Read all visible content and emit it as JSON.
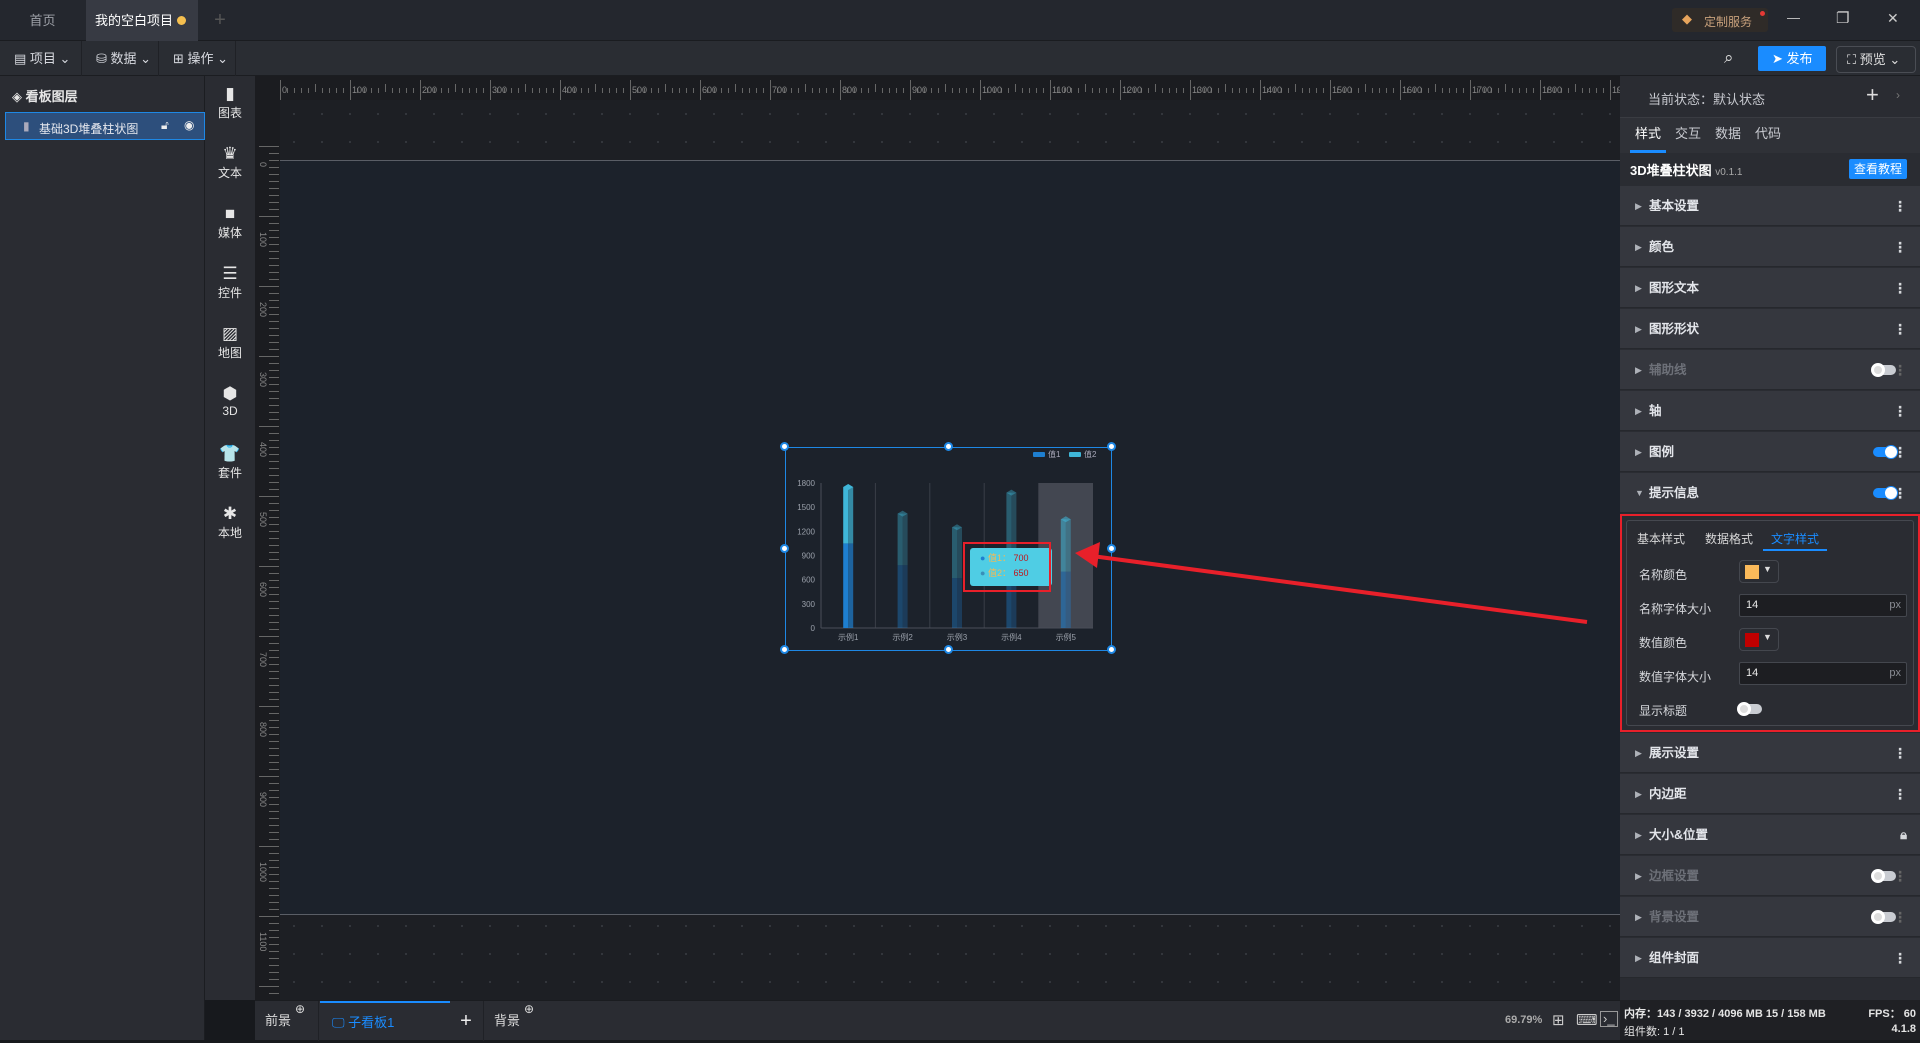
{
  "tabs": [
    {
      "label": "首页",
      "active": false
    },
    {
      "label": "我的空白项目",
      "active": true,
      "unsaved": true
    }
  ],
  "window": {
    "service_label": "定制服务",
    "minimize": "—",
    "restore": "❐",
    "close": "✕"
  },
  "toolbar": {
    "menus": [
      {
        "label": "项目",
        "icon": "file-icon"
      },
      {
        "label": "数据",
        "icon": "database-icon"
      },
      {
        "label": "操作",
        "icon": "grid-icon"
      }
    ],
    "publish_label": "发布",
    "preview_label": "预览"
  },
  "layers": {
    "title": "看板图层",
    "items": [
      {
        "label": "基础3D堆叠柱状图",
        "selected": true
      }
    ]
  },
  "component_tools": [
    {
      "label": "图表",
      "glyph": "▮"
    },
    {
      "label": "文本",
      "glyph": "♛"
    },
    {
      "label": "媒体",
      "glyph": "■"
    },
    {
      "label": "控件",
      "glyph": "☰"
    },
    {
      "label": "地图",
      "glyph": "▨"
    },
    {
      "label": "3D",
      "glyph": "⬢"
    },
    {
      "label": "套件",
      "glyph": "👕"
    },
    {
      "label": "本地",
      "glyph": "✱"
    }
  ],
  "ruler": {
    "top_labels": [
      "0",
      "100",
      "200",
      "300",
      "400",
      "500",
      "600",
      "700",
      "800",
      "900",
      "1000",
      "1100",
      "1200",
      "1300",
      "1400",
      "1500",
      "1600",
      "1700",
      "1800",
      "1900"
    ],
    "left_labels": [
      "0",
      "100",
      "200",
      "300",
      "400",
      "500",
      "600",
      "700",
      "800",
      "900",
      "1000",
      "1100"
    ]
  },
  "chart_data": {
    "type": "bar",
    "stacked": true,
    "style": "3d",
    "categories": [
      "示例1",
      "示例2",
      "示例3",
      "示例4",
      "示例5"
    ],
    "series": [
      {
        "name": "值1",
        "values": [
          1050,
          780,
          620,
          900,
          700
        ],
        "color": "#1e7fd0"
      },
      {
        "name": "值2",
        "values": [
          700,
          640,
          630,
          780,
          650
        ],
        "color": "#3fb6d8"
      }
    ],
    "yticks": [
      "0",
      "300",
      "600",
      "900",
      "1200",
      "1500",
      "1800"
    ],
    "ylim": [
      0,
      1800
    ],
    "legend": "top-right",
    "highlighted_category": "示例5",
    "tooltip": {
      "rows": [
        {
          "name": "值1：",
          "value": "700"
        },
        {
          "name": "值2：",
          "value": "650"
        }
      ],
      "background": "#4fcde4",
      "name_color": "#f5b955",
      "value_color": "#c0151b"
    }
  },
  "bottom": {
    "foreground": "前景",
    "subboard": "子看板1",
    "add": "+",
    "background": "背景",
    "zoom": "69.79%"
  },
  "right": {
    "state_label": "当前状态：默认状态",
    "tabs": [
      "样式",
      "交互",
      "数据",
      "代码"
    ],
    "active_tab": "样式",
    "component_title": "3D堆叠柱状图",
    "version": "v0.1.1",
    "tutorial_label": "查看教程",
    "sections_top": [
      {
        "label": "基本设置"
      },
      {
        "label": "颜色"
      },
      {
        "label": "图形文本"
      },
      {
        "label": "图形形状"
      },
      {
        "label": "辅助线",
        "toggle": false,
        "dim": true
      },
      {
        "label": "轴"
      },
      {
        "label": "图例",
        "toggle": true
      },
      {
        "label": "提示信息",
        "toggle": true,
        "expanded": true
      }
    ],
    "tooltip_panel": {
      "subtabs": [
        "基本样式",
        "数据格式",
        "文字样式"
      ],
      "active_subtab": "文字样式",
      "name_color_label": "名称颜色",
      "name_color": "#f9b95a",
      "name_size_label": "名称字体大小",
      "name_size": "14",
      "unit": "px",
      "value_color_label": "数值颜色",
      "value_color": "#c00000",
      "value_size_label": "数值字体大小",
      "value_size": "14",
      "show_title_label": "显示标题",
      "show_title": false
    },
    "sections_bottom": [
      {
        "label": "展示设置"
      },
      {
        "label": "内边距"
      },
      {
        "label": "大小&位置",
        "lock": true
      },
      {
        "label": "边框设置",
        "toggle": false,
        "dim": true
      },
      {
        "label": "背景设置",
        "toggle": false,
        "dim": true
      },
      {
        "label": "组件封面"
      }
    ]
  },
  "status": {
    "memory": "内存：143 / 3932 / 4096 MB  15 / 158 MB",
    "fps": "FPS：  60",
    "components": "组件数: 1 / 1",
    "version": "4.1.8"
  },
  "annotation_color": "#e8202a"
}
